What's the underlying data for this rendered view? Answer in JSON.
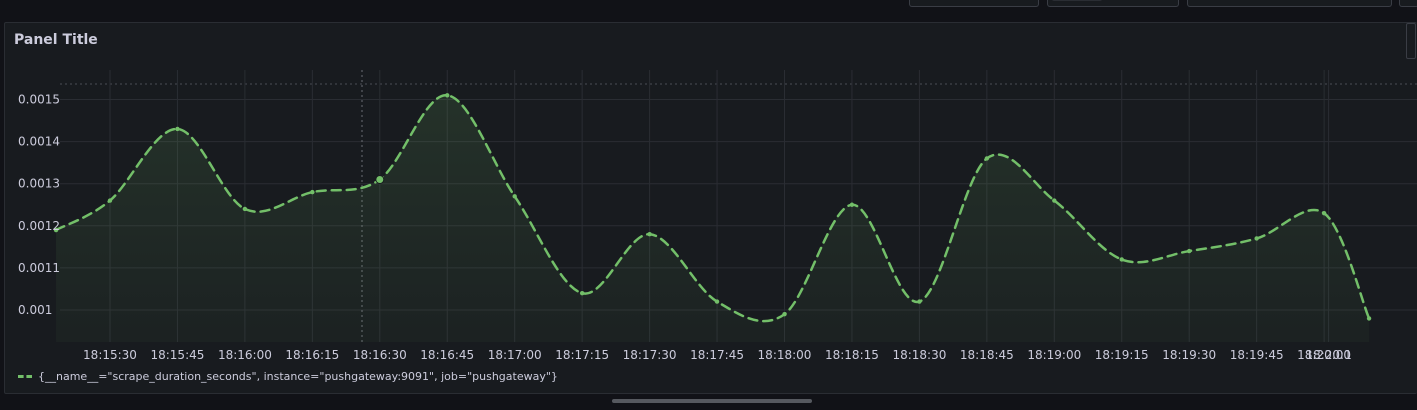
{
  "panel": {
    "title": "Panel Title"
  },
  "legend": {
    "label": "{__name__=\"scrape_duration_seconds\", instance=\"pushgateway:9091\", job=\"pushgateway\"}"
  },
  "colors": {
    "series": "#73bf69",
    "background": "#181b1f",
    "grid": "#2a2d33",
    "text": "#ccccdc"
  },
  "chart_data": {
    "type": "line",
    "style": "dashed line with area fill",
    "x_ticks": [
      "18:15:30",
      "18:15:45",
      "18:16:00",
      "18:16:15",
      "18:16:30",
      "18:16:45",
      "18:17:00",
      "18:17:15",
      "18:17:30",
      "18:17:45",
      "18:18:00",
      "18:18:15",
      "18:18:30",
      "18:18:45",
      "18:19:00",
      "18:19:15",
      "18:19:30",
      "18:19:45",
      "18:20:00",
      "18:20:1"
    ],
    "y_ticks": [
      "0.001",
      "0.0011",
      "0.0012",
      "0.0013",
      "0.0014",
      "0.0015"
    ],
    "ylim": [
      0.00092,
      0.00154
    ],
    "grid": true,
    "legend_position": "bottom-left",
    "series": [
      {
        "x": [
          "18:15:18",
          "18:15:30",
          "18:15:45",
          "18:16:00",
          "18:16:15",
          "18:16:30",
          "18:16:45",
          "18:17:00",
          "18:17:15",
          "18:17:30",
          "18:17:45",
          "18:18:00",
          "18:18:15",
          "18:18:30",
          "18:18:45",
          "18:19:00",
          "18:19:15",
          "18:19:30",
          "18:19:45",
          "18:20:00",
          "18:20:10"
        ],
        "y": [
          0.00119,
          0.00126,
          0.00143,
          0.00124,
          0.00128,
          0.00131,
          0.00151,
          0.00127,
          0.00104,
          0.00118,
          0.00102,
          0.00099,
          0.00125,
          0.00102,
          0.00136,
          0.00126,
          0.00112,
          0.00114,
          0.00117,
          0.00123,
          0.00098
        ]
      }
    ]
  }
}
